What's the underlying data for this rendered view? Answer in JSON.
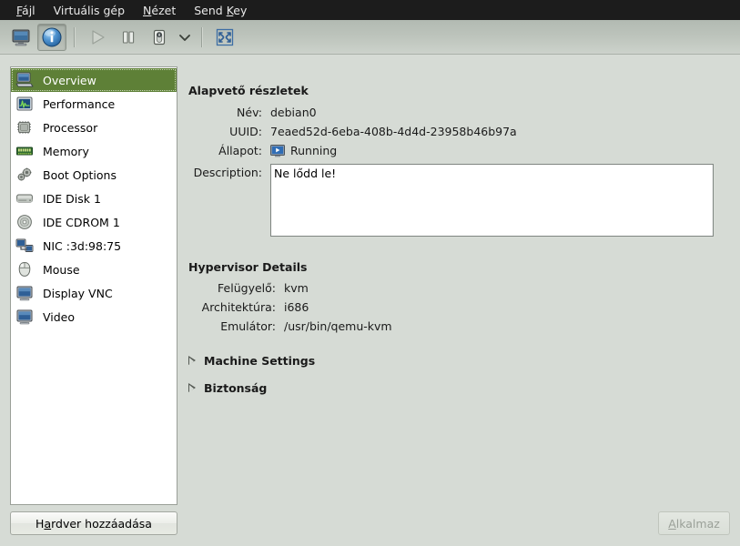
{
  "window": {
    "bg_color": "#d6dbd5",
    "selection_color": "#5e8037"
  },
  "menubar": {
    "items": [
      {
        "name": "file",
        "label_pre": "",
        "label_mn": "F",
        "label_post": "ájl"
      },
      {
        "name": "virtual-machine",
        "label_pre": "Virtuális gép",
        "label_mn": "",
        "label_post": ""
      },
      {
        "name": "view",
        "label_pre": "",
        "label_mn": "N",
        "label_post": "ézet"
      },
      {
        "name": "send-key",
        "label_pre": "Send ",
        "label_mn": "K",
        "label_post": "ey"
      }
    ]
  },
  "toolbar": {
    "buttons": [
      {
        "name": "show-console-button",
        "icon": "monitor-icon",
        "state": "normal"
      },
      {
        "name": "show-details-button",
        "icon": "info-icon",
        "state": "active"
      },
      {
        "name": "run-button",
        "icon": "play-icon",
        "state": "disabled"
      },
      {
        "name": "pause-button",
        "icon": "pause-icon",
        "state": "normal"
      },
      {
        "name": "shutdown-button",
        "icon": "power-switch-icon",
        "state": "normal"
      },
      {
        "name": "shutdown-menu-button",
        "icon": "chevron-down-icon",
        "state": "normal"
      },
      {
        "name": "fullscreen-button",
        "icon": "fullscreen-icon",
        "state": "normal"
      }
    ]
  },
  "sidebar": {
    "items": [
      {
        "label": "Overview",
        "icon": "computer-icon",
        "selected": true
      },
      {
        "label": "Performance",
        "icon": "performance-graph-icon",
        "selected": false
      },
      {
        "label": "Processor",
        "icon": "cpu-chip-icon",
        "selected": false
      },
      {
        "label": "Memory",
        "icon": "memory-stick-icon",
        "selected": false
      },
      {
        "label": "Boot Options",
        "icon": "gears-icon",
        "selected": false
      },
      {
        "label": "IDE Disk 1",
        "icon": "harddisk-icon",
        "selected": false
      },
      {
        "label": "IDE CDROM 1",
        "icon": "cdrom-icon",
        "selected": false
      },
      {
        "label": "NIC :3d:98:75",
        "icon": "network-icon",
        "selected": false
      },
      {
        "label": "Mouse",
        "icon": "mouse-icon",
        "selected": false
      },
      {
        "label": "Display VNC",
        "icon": "display-icon",
        "selected": false
      },
      {
        "label": "Video",
        "icon": "video-icon",
        "selected": false
      }
    ],
    "add_hardware_button": {
      "label_pre": "H",
      "label_mn": "a",
      "label_post": "rdver hozzáadása"
    }
  },
  "details": {
    "basic_section_title": "Alapvető részletek",
    "fields": {
      "name_label": "Név:",
      "name_value": "debian0",
      "uuid_label": "UUID:",
      "uuid_value": "7eaed52d-6eba-408b-4d4d-23958b46b97a",
      "state_label": "Állapot:",
      "state_value": "Running",
      "state_icon": "running-monitor-icon",
      "description_label": "Description:",
      "description_value": "Ne lődd le!"
    },
    "hypervisor_section_title": "Hypervisor Details",
    "hypervisor": {
      "hypervisor_label": "Felügyelő:",
      "hypervisor_value": "kvm",
      "arch_label": "Architektúra:",
      "arch_value": "i686",
      "emulator_label": "Emulátor:",
      "emulator_value": "/usr/bin/qemu-kvm"
    },
    "expanders": [
      {
        "label": "Machine Settings",
        "expanded": false
      },
      {
        "label": "Biztonság",
        "expanded": false
      }
    ],
    "apply_button": {
      "label_pre": "",
      "label_mn": "A",
      "label_post": "lkalmaz",
      "enabled": false
    }
  }
}
